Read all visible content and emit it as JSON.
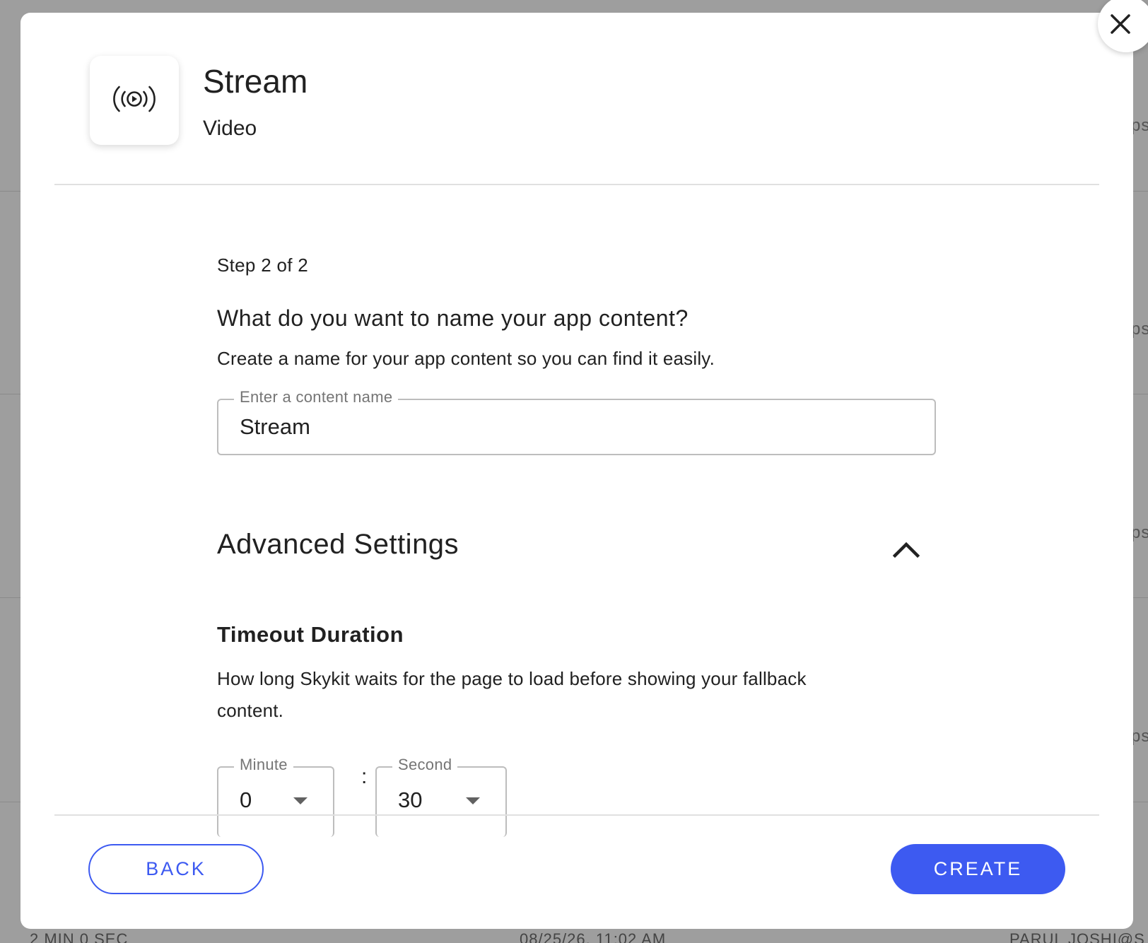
{
  "background": {
    "row_fragment": "ps",
    "footer": {
      "duration": "2 MIN 0 SEC",
      "timestamp": "08/25/26, 11:02 AM",
      "user": "PARUL JOSHI@S"
    }
  },
  "header": {
    "icon": "broadcast-play-icon",
    "title": "Stream",
    "subtitle": "Video"
  },
  "step": {
    "label": "Step 2 of 2",
    "question": "What do you want to name your app content?",
    "help": "Create a name for your app content so you can find it easily."
  },
  "name_field": {
    "label": "Enter a content name",
    "value": "Stream"
  },
  "advanced": {
    "title": "Advanced Settings",
    "expanded": true,
    "timeout_title": "Timeout Duration",
    "timeout_help": "How long Skykit waits for the page to load before showing your fallback content.",
    "minute": {
      "label": "Minute",
      "value": "0"
    },
    "separator": ":",
    "second": {
      "label": "Second",
      "value": "30"
    }
  },
  "footer": {
    "back_label": "BACK",
    "create_label": "CREATE"
  },
  "colors": {
    "accent": "#3d5af1",
    "overlay": "#9e9e9e"
  }
}
